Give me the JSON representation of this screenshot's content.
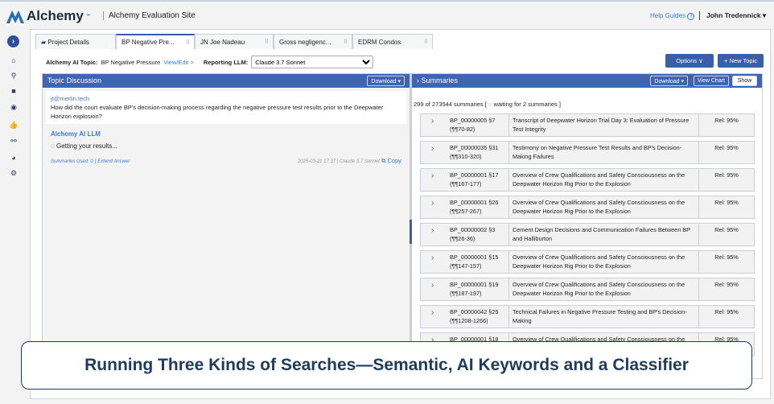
{
  "header": {
    "logo": "Alchemy",
    "logo_tm": "™",
    "site": "Alchemy Evaluation Site",
    "help": "Help Guides",
    "user": "John Tredennick"
  },
  "sidebar": {
    "icons": [
      "chevron-right",
      "home",
      "search",
      "folder",
      "chat",
      "thumbs-up",
      "link",
      "chart-pie",
      "gear"
    ]
  },
  "tabs": [
    {
      "label": "Project Details"
    },
    {
      "label": "BP Negative Pre..."
    },
    {
      "label": "JN Joe Nadeau"
    },
    {
      "label": "Gross negligenc..."
    },
    {
      "label": "EDRM Condos"
    }
  ],
  "topic": {
    "label": "Alchemy AI Topic:",
    "value": "BP Negative Pressure",
    "view_edit": "View/Edit >",
    "llm_label": "Reporting LLM:",
    "llm_value": "Claude 3.7 Sonnet"
  },
  "buttons": {
    "options": "Options ∨",
    "new_topic": "+ New Topic"
  },
  "discussion": {
    "title": "Topic Discussion",
    "download": "Download ▾",
    "user": "jt@merlin.tech",
    "question": "How did the court evaluate BP's decision-making process regarding the negative pressure test results prior to the Deepwater Horizon explosion?",
    "ai_name": "Alchemy AI LLM",
    "status": "Getting your results...",
    "summaries_used": "Summaries Used: 0 |",
    "extend": "Extend Answer",
    "meta": "2025-03-21 17:37 | Claude 3.7 Sonnet",
    "copy": "Copy"
  },
  "summaries": {
    "title": "Summaries",
    "download": "Download ▾",
    "view_chart": "View Chart",
    "show": "Show",
    "count": "299 of 273544 summaries",
    "waiting": "waiting for 2 summaries ]",
    "rows": [
      {
        "id": "BP_00000005 §7",
        "para": "(¶¶70-82)",
        "title": "Transcript of Deepwater Horizon Trial Day 3: Evaluation of Pressure Test Integrity",
        "rel": "Rel: 95%"
      },
      {
        "id": "BP_00000035 §31",
        "para": "(¶¶310-320)",
        "title": "Testimony on Negative Pressure Test Results and BP's Decision-Making Failures",
        "rel": "Rel: 95%"
      },
      {
        "id": "BP_00000001 §17",
        "para": "(¶¶167-177)",
        "title": "Overview of Crew Qualifications and Safety Consciousness on the Deepwater Horizon Rig Prior to the Explosion",
        "rel": "Rel: 95%"
      },
      {
        "id": "BP_00000001 §26",
        "para": "(¶¶257-267)",
        "title": "Overview of Crew Qualifications and Safety Consciousness on the Deepwater Horizon Rig Prior to the Explosion",
        "rel": "Rel: 95%"
      },
      {
        "id": "BP_00000002 §3",
        "para": "(¶¶26-36)",
        "title": "Cement Design Decisions and Communication Failures Between BP and Halliburton",
        "rel": "Rel: 95%"
      },
      {
        "id": "BP_00000001 §15",
        "para": "(¶¶147-157)",
        "title": "Overview of Crew Qualifications and Safety Consciousness on the Deepwater Horizon Rig Prior to the Explosion",
        "rel": "Rel: 95%"
      },
      {
        "id": "BP_00000001 §19",
        "para": "(¶¶187-197)",
        "title": "Overview of Crew Qualifications and Safety Consciousness on the Deepwater Horizon Rig Prior to the Explosion",
        "rel": "Rel: 95%"
      },
      {
        "id": "BP_00000042 §25",
        "para": "(¶¶1208-1266)",
        "title": "Technical Failures in Negative Pressure Testing and BP's Decision-Making",
        "rel": "Rel: 95%"
      },
      {
        "id": "BP_00000001 §18",
        "para": "",
        "title": "Overview of Crew Qualifications and Safety Consciousness on the",
        "rel": "Rel: 95%"
      }
    ]
  },
  "caption": "Running Three Kinds of Searches—Semantic, AI Keywords and a Classifier"
}
